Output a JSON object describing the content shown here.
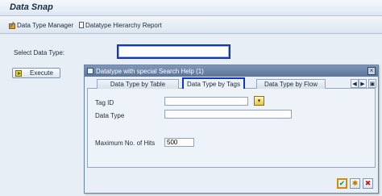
{
  "window": {
    "title": "Data Snap"
  },
  "toolbar": {
    "items": [
      {
        "label": "Data Type Manager",
        "icon": "edit-pencil-icon"
      },
      {
        "label": "Datatype Hierarchy Report",
        "icon": "document-icon"
      }
    ]
  },
  "form": {
    "select_label": "Select Data Type:",
    "select_value": "",
    "execute_label": "Execute"
  },
  "dialog": {
    "title": "Datatype with special Search Help (1)",
    "close_glyph": "×",
    "tabs": [
      {
        "label": "Data Type by Table",
        "active": false
      },
      {
        "label": "Data Type by Tags",
        "active": true
      },
      {
        "label": "Data Type by Flow",
        "active": false
      }
    ],
    "tab_nav": {
      "prev": "◀",
      "next": "▶",
      "menu": "▣"
    },
    "fields": {
      "tag_id": {
        "label": "Tag ID",
        "value": ""
      },
      "data_type": {
        "label": "Data Type",
        "value": ""
      },
      "max_hits": {
        "label": "Maximum No. of Hits",
        "value": "500"
      }
    },
    "help_glyph": "▾",
    "footer": {
      "ok_glyph": "✔",
      "search_glyph": "✱",
      "cancel_glyph": "✖"
    }
  },
  "colors": {
    "focus_border": "#1236c4",
    "dialog_title_bg": "#6f88ab",
    "background": "#e7eef6"
  }
}
